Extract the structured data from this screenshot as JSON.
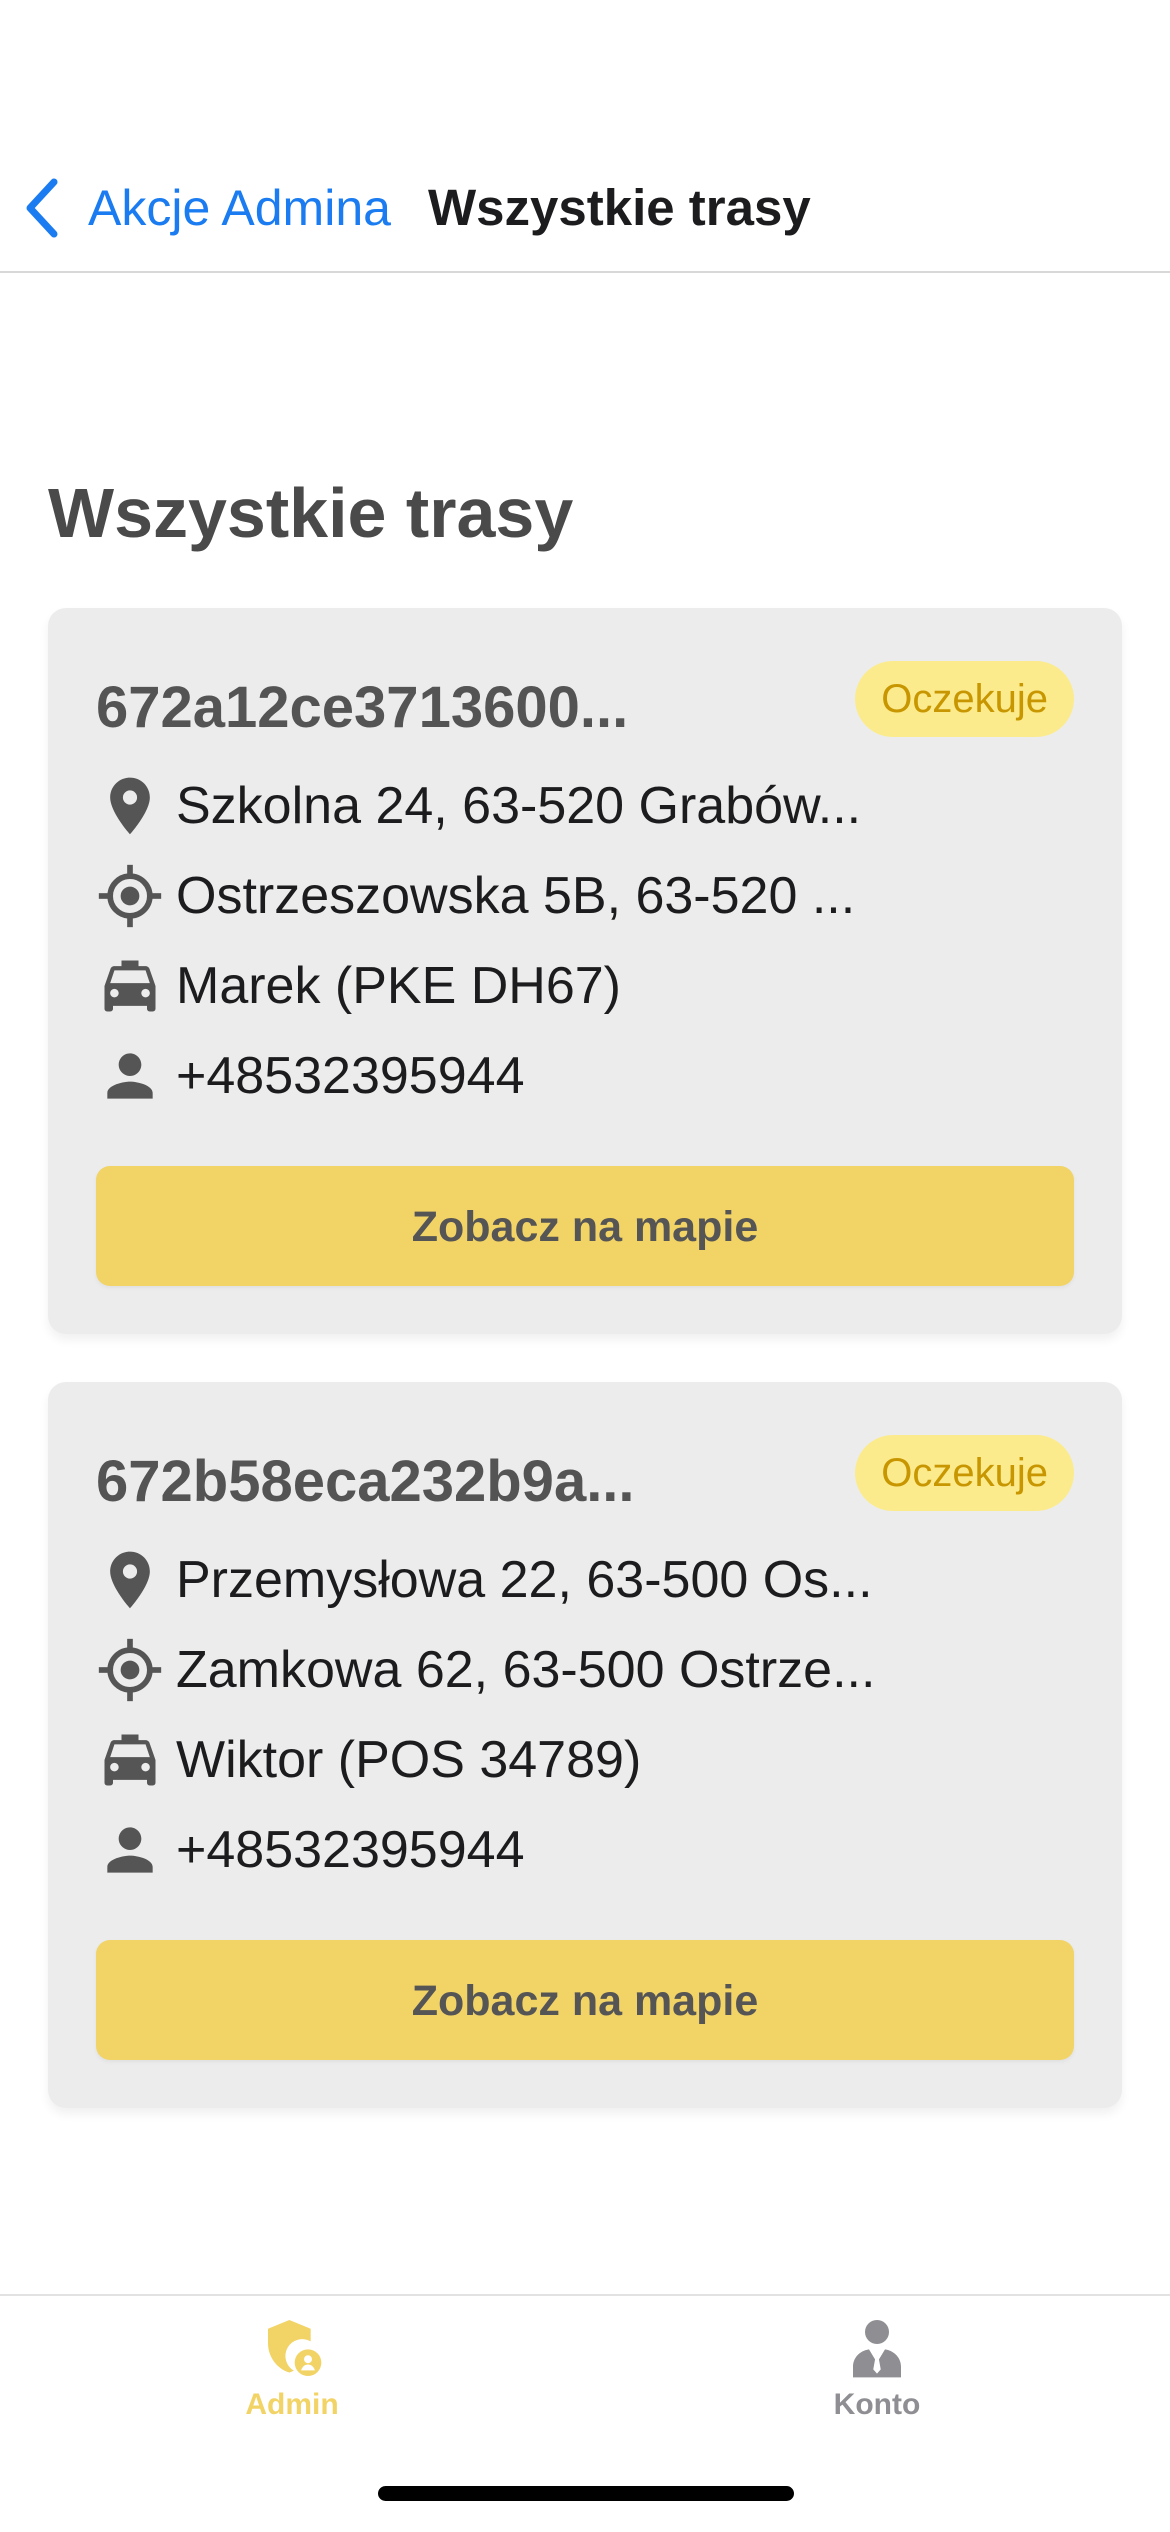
{
  "nav": {
    "back_label": "Akcje Admina",
    "title": "Wszystkie trasy"
  },
  "page": {
    "heading": "Wszystkie trasy"
  },
  "routes": [
    {
      "id": "672a12ce3713600...",
      "status": "Oczekuje",
      "pickup": "Szkolna 24, 63-520 Grabów...",
      "destination": "Ostrzeszowska 5B, 63-520 ...",
      "driver": "Marek (PKE DH67)",
      "phone": "+48532395944",
      "map_button": "Zobacz na mapie"
    },
    {
      "id": "672b58eca232b9a...",
      "status": "Oczekuje",
      "pickup": "Przemysłowa 22, 63-500 Os...",
      "destination": "Zamkowa 62, 63-500 Ostrze...",
      "driver": "Wiktor (POS 34789)",
      "phone": "+48532395944",
      "map_button": "Zobacz na mapie"
    }
  ],
  "tabbar": {
    "admin_label": "Admin",
    "konto_label": "Konto"
  },
  "icons": {
    "back": "chevron-left-icon",
    "pickup": "map-pin-icon",
    "destination": "crosshair-icon",
    "driver": "car-icon",
    "phone": "person-icon",
    "admin_tab": "shield-user-icon",
    "konto_tab": "user-tie-icon"
  },
  "colors": {
    "accent_blue": "#1a7cf0",
    "card_bg": "#ececec",
    "button_yellow": "#f2d366",
    "badge_bg": "#fbeb8c",
    "badge_text": "#c89600",
    "tab_active": "#f2d366",
    "tab_inactive": "#8e8e93"
  }
}
